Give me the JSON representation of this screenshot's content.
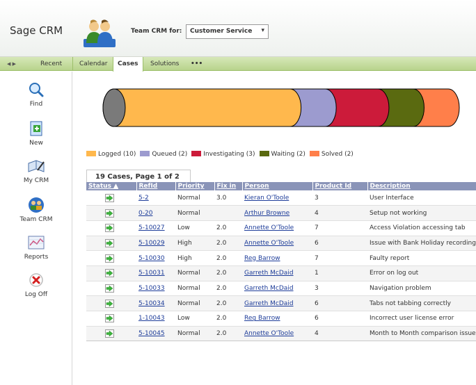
{
  "app": {
    "title": "Sage CRM",
    "team_for_label": "Team CRM for:",
    "team_selected": "Customer Service"
  },
  "tabbar": {
    "nav_arrows": "◀ ▶",
    "recent": "Recent",
    "tabs": [
      {
        "label": "Calendar",
        "active": false
      },
      {
        "label": "Cases",
        "active": true
      },
      {
        "label": "Solutions",
        "active": false
      },
      {
        "label": "•••",
        "active": false
      }
    ]
  },
  "sidebar": {
    "items": [
      {
        "label": "Find",
        "icon": "magnifier-icon"
      },
      {
        "label": "New",
        "icon": "new-document-icon"
      },
      {
        "label": "My CRM",
        "icon": "notebook-pen-icon"
      },
      {
        "label": "Team CRM",
        "icon": "team-people-icon"
      },
      {
        "label": "Reports",
        "icon": "report-chart-icon"
      },
      {
        "label": "Log Off",
        "icon": "red-x-icon"
      }
    ]
  },
  "pipeline": {
    "segments": [
      {
        "label": "Logged",
        "count": 10,
        "color": "#ffb84d"
      },
      {
        "label": "Queued",
        "count": 2,
        "color": "#9c9bcf"
      },
      {
        "label": "Investigating",
        "count": 3,
        "color": "#cc1b3a"
      },
      {
        "label": "Waiting",
        "count": 2,
        "color": "#5a6a10"
      },
      {
        "label": "Solved",
        "count": 2,
        "color": "#ff7f4a"
      }
    ],
    "legend": [
      "Logged (10)",
      "Queued (2)",
      "Investigating (3)",
      "Waiting (2)",
      "Solved (2)"
    ]
  },
  "grid": {
    "caption": "19 Cases, Page 1 of 2",
    "headers": [
      "Status ▲",
      "RefId",
      "Priority",
      "Fix in",
      "Person",
      "Product Id",
      "Description"
    ],
    "rows": [
      [
        "5-2",
        "Normal",
        "3.0",
        "Kieran O'Toole",
        "3",
        "User Interface"
      ],
      [
        "0-20",
        "Normal",
        "",
        "Arthur Browne",
        "4",
        "Setup not working"
      ],
      [
        "5-10027",
        "Low",
        "2.0",
        "Annette O'Toole",
        "7",
        "Access Violation accessing tab"
      ],
      [
        "5-10029",
        "High",
        "2.0",
        "Annette O'Toole",
        "6",
        "Issue with Bank Holiday recording"
      ],
      [
        "5-10030",
        "High",
        "2.0",
        "Reg Barrow",
        "7",
        "Faulty report"
      ],
      [
        "5-10031",
        "Normal",
        "2.0",
        "Garreth McDaid",
        "1",
        "Error on log out"
      ],
      [
        "5-10033",
        "Normal",
        "2.0",
        "Garreth McDaid",
        "3",
        "Navigation problem"
      ],
      [
        "5-10034",
        "Normal",
        "2.0",
        "Garreth McDaid",
        "6",
        "Tabs not tabbing correctly"
      ],
      [
        "1-10043",
        "Low",
        "2.0",
        "Reg Barrow",
        "6",
        "Incorrect user license error"
      ],
      [
        "5-10045",
        "Normal",
        "2.0",
        "Annette O'Toole",
        "4",
        "Month to Month comparison issue"
      ]
    ]
  }
}
